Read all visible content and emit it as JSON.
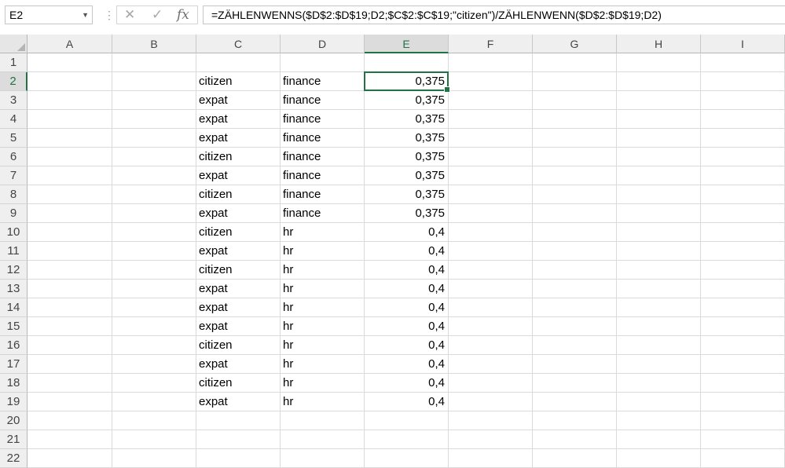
{
  "formula_bar": {
    "name_box": "E2",
    "name_box_arrow": "▼",
    "separator": "⋮",
    "cancel_glyph": "✕",
    "enter_glyph": "✓",
    "fx_glyph": "fx",
    "formula": "=ZÄHLENWENNS($D$2:$D$19;D2;$C$2:$C$19;\"citizen\")/ZÄHLENWENN($D$2:$D$19;D2)"
  },
  "sheet": {
    "selected_cell": "E2",
    "columns": [
      "A",
      "B",
      "C",
      "D",
      "E",
      "F",
      "G",
      "H",
      "I"
    ],
    "rows": [
      "1",
      "2",
      "3",
      "4",
      "5",
      "6",
      "7",
      "8",
      "9",
      "10",
      "11",
      "12",
      "13",
      "14",
      "15",
      "16",
      "17",
      "18",
      "19",
      "20",
      "21",
      "22"
    ],
    "data": [
      {
        "c": "",
        "d": "",
        "e": ""
      },
      {
        "c": "citizen",
        "d": "finance",
        "e": "0,375"
      },
      {
        "c": "expat",
        "d": "finance",
        "e": "0,375"
      },
      {
        "c": "expat",
        "d": "finance",
        "e": "0,375"
      },
      {
        "c": "expat",
        "d": "finance",
        "e": "0,375"
      },
      {
        "c": "citizen",
        "d": "finance",
        "e": "0,375"
      },
      {
        "c": "expat",
        "d": "finance",
        "e": "0,375"
      },
      {
        "c": "citizen",
        "d": "finance",
        "e": "0,375"
      },
      {
        "c": "expat",
        "d": "finance",
        "e": "0,375"
      },
      {
        "c": "citizen",
        "d": "hr",
        "e": "0,4"
      },
      {
        "c": "expat",
        "d": "hr",
        "e": "0,4"
      },
      {
        "c": "citizen",
        "d": "hr",
        "e": "0,4"
      },
      {
        "c": "expat",
        "d": "hr",
        "e": "0,4"
      },
      {
        "c": "expat",
        "d": "hr",
        "e": "0,4"
      },
      {
        "c": "expat",
        "d": "hr",
        "e": "0,4"
      },
      {
        "c": "citizen",
        "d": "hr",
        "e": "0,4"
      },
      {
        "c": "expat",
        "d": "hr",
        "e": "0,4"
      },
      {
        "c": "citizen",
        "d": "hr",
        "e": "0,4"
      },
      {
        "c": "expat",
        "d": "hr",
        "e": "0,4"
      },
      {
        "c": "",
        "d": "",
        "e": ""
      },
      {
        "c": "",
        "d": "",
        "e": ""
      },
      {
        "c": "",
        "d": "",
        "e": ""
      }
    ]
  },
  "colors": {
    "accent": "#217346"
  }
}
